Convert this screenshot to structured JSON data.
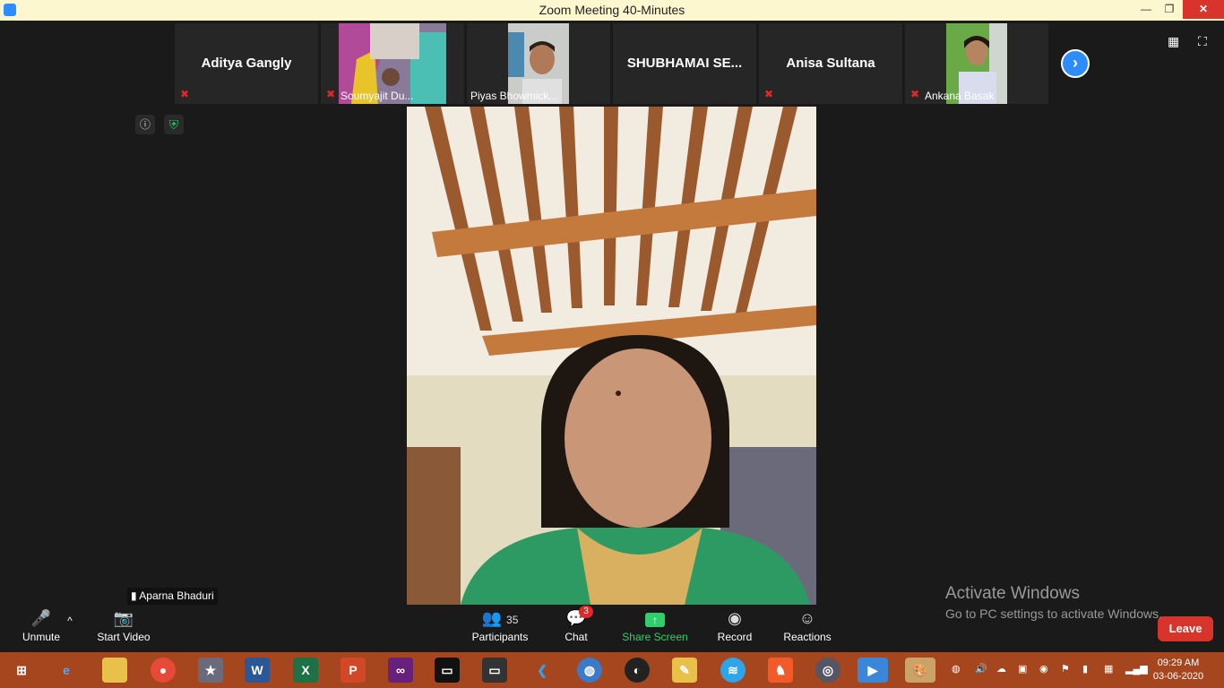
{
  "window": {
    "title": "Zoom Meeting 40-Minutes",
    "minimize": "—",
    "maximize": "❐",
    "close": "✕"
  },
  "participants_strip": [
    {
      "name": "Aditya Gangly",
      "type": "name"
    },
    {
      "name": "Soumyajit Du...",
      "type": "video"
    },
    {
      "name": "Piyas Bhowmick...",
      "type": "video"
    },
    {
      "name": "SHUBHAMAI SE...",
      "type": "name"
    },
    {
      "name": "Anisa Sultana",
      "type": "name"
    },
    {
      "name": "Ankana Basak",
      "type": "video"
    }
  ],
  "speaker": {
    "name": "Aparna Bhaduri"
  },
  "toolbar": {
    "unmute": "Unmute",
    "start_video": "Start Video",
    "participants": "Participants",
    "participants_count": "35",
    "chat": "Chat",
    "chat_badge": "3",
    "share": "Share Screen",
    "record": "Record",
    "reactions": "Reactions",
    "leave": "Leave"
  },
  "watermark": {
    "title": "Activate Windows",
    "subtitle": "Go to PC settings to activate Windows."
  },
  "clock": {
    "time": "09:29 AM",
    "date": "03-06-2020"
  },
  "colors": {
    "accent": "#2d8cff",
    "leave": "#d9342b",
    "share_green": "#2fd06b",
    "taskbar": "#a5461f",
    "titlebar": "#fdf7cf"
  }
}
